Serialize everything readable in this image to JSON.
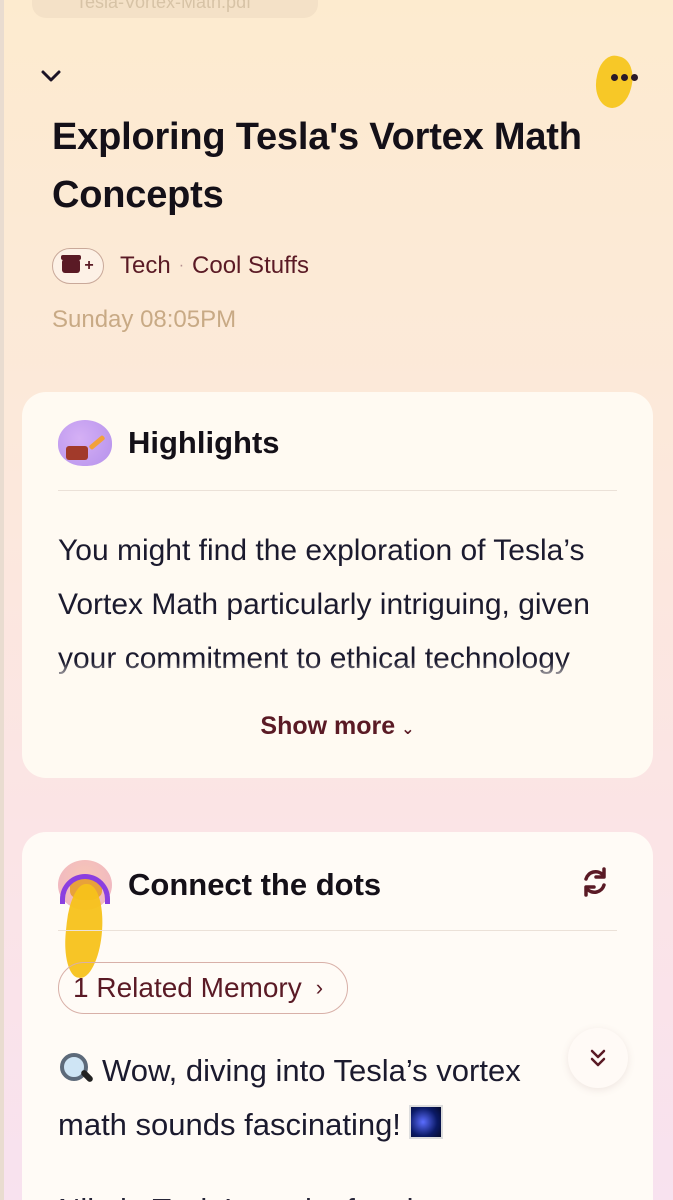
{
  "top": {
    "file_pill": "Tesla-Vortex-Math.pdf"
  },
  "header": {
    "back_icon": "chevron-down-icon",
    "more_icon": "more-horizontal-icon",
    "title": "Exploring Tesla's Vortex Math Concepts"
  },
  "tags": {
    "add_icon": "collection-add-icon",
    "items": [
      "Tech",
      "Cool Stuffs"
    ],
    "separator": "·"
  },
  "date": "Sunday 08:05PM",
  "highlights": {
    "label": "Highlights",
    "text": "You might find the exploration of Tesla’s Vortex Math particularly intriguing, given your commitment to ethical technology and innovation",
    "show_more": "Show more",
    "show_more_icon": "chevron-down-icon"
  },
  "connect": {
    "label": "Connect the dots",
    "refresh_icon": "refresh-icon",
    "related_label": "1 Related Memory",
    "related_icon": "chevron-right-icon",
    "chat_text_1": "Wow, diving into Tesla’s vortex math sounds fascinating!",
    "chat_text_2": "Nikola Tesla’s work often intersects",
    "scroll_icon": "double-chevron-down-icon"
  },
  "colors": {
    "accent": "#5a1a25",
    "highlighter": "#f7c21a",
    "date": "#c8aa85"
  }
}
